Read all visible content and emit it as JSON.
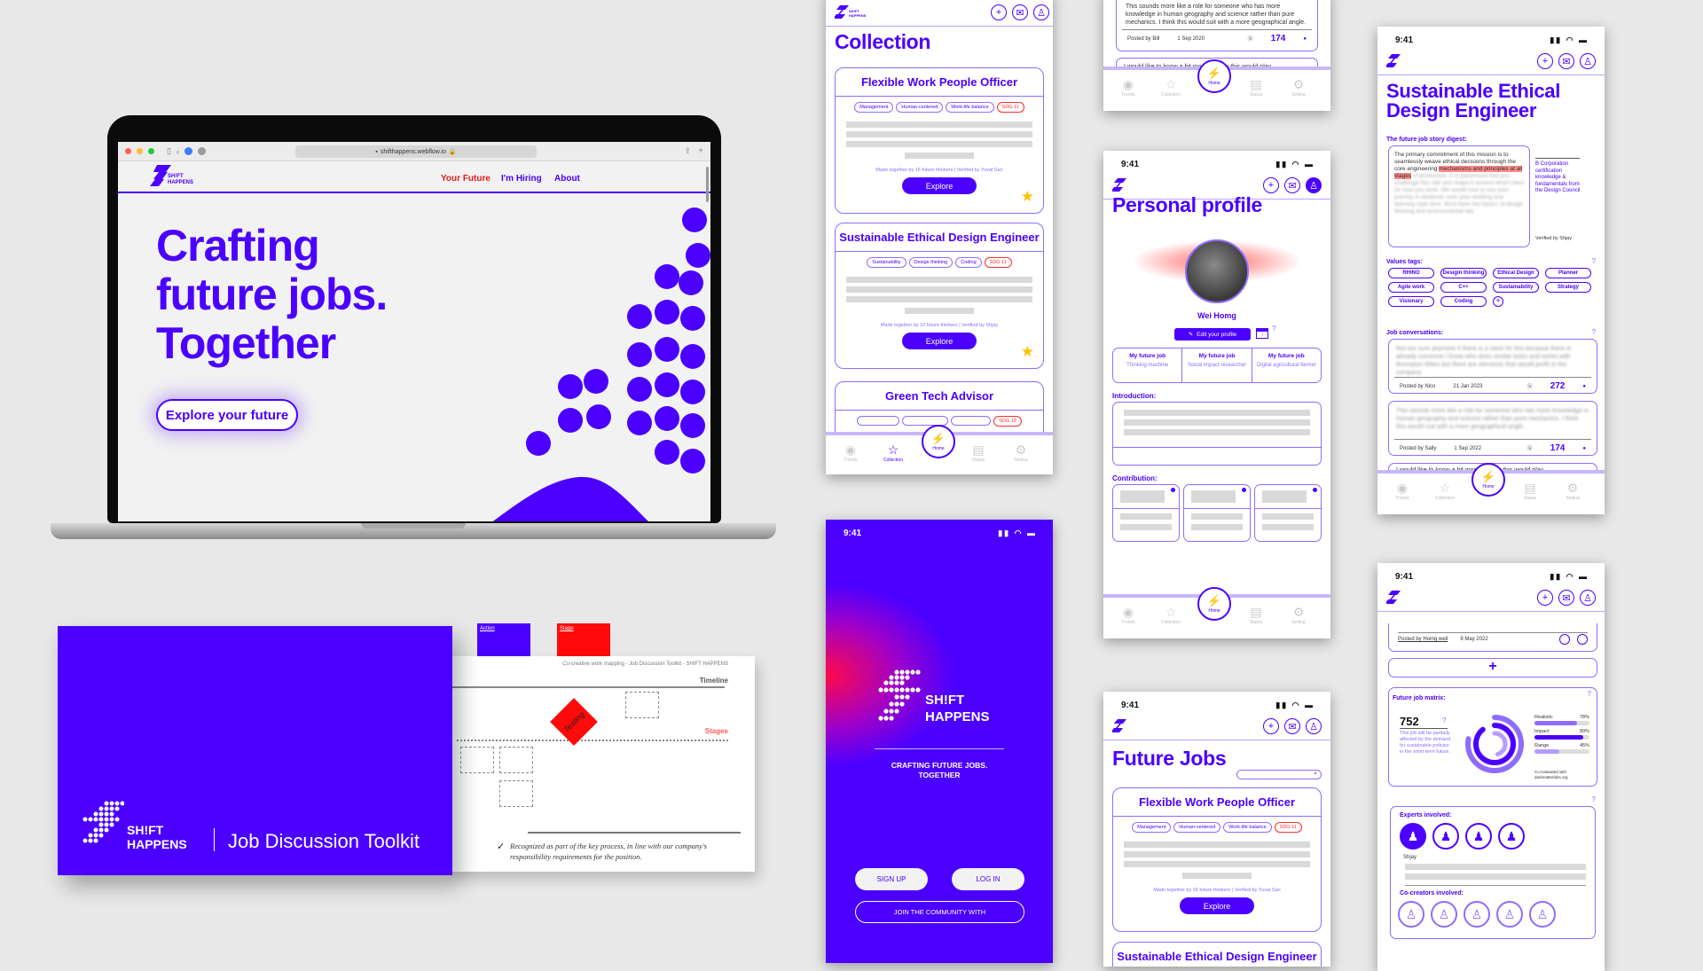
{
  "laptop": {
    "browser_url": "shifthappens.webflow.io",
    "logo_line1": "SH!FT",
    "logo_line2": "HAPPENS",
    "nav": [
      {
        "label": "Your Future",
        "active": true
      },
      {
        "label": "I'm Hiring",
        "active": false
      },
      {
        "label": "About",
        "active": false
      }
    ],
    "hero_line1": "Crafting",
    "hero_line2": "future jobs.",
    "hero_line3": "Together",
    "cta_label": "Explore your future"
  },
  "toolkit": {
    "brand_line1": "SH!FT",
    "brand_line2": "HAPPENS",
    "title": "Job Discussion Toolkit",
    "card_action": "Action",
    "card_stage": "Stage",
    "sheet_header": "Co-creative work mapping - Job Discussion Toolkit - SHIFT HAPPENS",
    "timeline_label": "Timeline",
    "stages_label": "Stages",
    "diamond_small": "Stage",
    "diamond_text": "Testing",
    "note": "Recognized as part of the key process, in line with our company's responsibility requirements for the position."
  },
  "common": {
    "time": "9:41",
    "logo_line1": "SH!FT",
    "logo_line2": "HAPPENS",
    "tabs": [
      "Trends",
      "Collection",
      "Home",
      "Status",
      "Setting"
    ]
  },
  "collection": {
    "title": "Collection",
    "cards": [
      {
        "title": "Flexible Work People Officer",
        "tags": [
          "Management",
          "Human-centered",
          "Work-life balance"
        ],
        "sdg": "SDG 11",
        "made": "Made together by 16 future thinkers | Verified by Yuval Sari",
        "button": "Explore"
      },
      {
        "title": "Sustainable Ethical Design Engineer",
        "tags": [
          "Sustainability",
          "Design thinking",
          "Coding"
        ],
        "sdg": "SDG 11",
        "made": "Made together by 16 future thinkers | Verified by Shjay",
        "button": "Explore"
      },
      {
        "title": "Green Tech Advisor",
        "tags": [
          "",
          "",
          ""
        ],
        "sdg": "SDG 13"
      }
    ],
    "active_tab": "Collection"
  },
  "splash": {
    "brand_line1": "SH!FT",
    "brand_line2": "HAPPENS",
    "tagline_line1": "CRAFTING FUTURE JOBS.",
    "tagline_line2": "TOGETHER",
    "signup": "SIGN UP",
    "login": "LOG IN",
    "join": "JOIN THE COMMUNITY WITH"
  },
  "conversation_top": {
    "text": "This sounds more like a role for someone who has more knowledge in human geography and science rather than pure mechanics. I think this would suit with a more geographical angle.",
    "posted_by": "Posted by Bill",
    "date": "1 Sep 2020",
    "count": "174",
    "next_text": "I would like to know a bit more on how this would play"
  },
  "profile": {
    "title": "Personal profile",
    "name": "Wei Homg",
    "edit_button": "Edit your profile",
    "future_jobs": [
      {
        "label": "My future job",
        "value": "Thinking machine"
      },
      {
        "label": "My future job",
        "value": "Social impact researcher"
      },
      {
        "label": "My future job",
        "value": "Digital agricultural farmer"
      }
    ],
    "introduction_label": "Introduction:",
    "contribution_label": "Contribution:"
  },
  "future_jobs": {
    "title": "Future Jobs",
    "search_placeholder": "",
    "card": {
      "title": "Flexible Work People Officer",
      "tags": [
        "Management",
        "Human-centered",
        "Work-life balance"
      ],
      "sdg": "SDG 11",
      "made": "Made together by 16 future thinkers | Verified by Yuval Sari",
      "button": "Explore"
    },
    "next_card_title": "Sustainable Ethical Design Engineer"
  },
  "job_detail": {
    "title_line1": "Sustainable Ethical",
    "title_line2": "Design Engineer",
    "digest_label": "The future job story digest:",
    "digest_text": "The primary commitment of this mission is to seamlessly weave ethical decisions through the core engineering",
    "digest_highlight": "mechanisms and principles at all stages",
    "digest_rest": "of production. It is paramount that you challenge this role and shape it around what's best for how you work. We would love to see your journey in whatever suits your working and learning style best. Must have the basics of design thinking and environmental law.",
    "side_note": "B Corporation certification knowledge & fundamentals from the Design Council",
    "verified": "Verified by Shjay",
    "values_label": "Values tags:",
    "values": [
      "RHINO",
      "Desigin thinking",
      "Ethical Design",
      "Planner",
      "Agile work",
      "C++",
      "Sustainability",
      "Strategy",
      "Visionary",
      "Coding"
    ],
    "conversations_label": "Job conversations:",
    "conversations": [
      {
        "text": "Not too sure anymore if there is a need for this because there is already someone I know who does similar tasks and works with Brompton Bikes but there are elements that would profit to the company",
        "posted_by": "Posted by Nico",
        "date": "21 Jan 2023",
        "count": "272"
      },
      {
        "text": "This sounds more like a role for someone who has more knowledge in human geography and science rather than pure mechanics. I think this would suit with a more geographical angle.",
        "posted_by": "Posted by Sally",
        "date": "1 Sep 2022",
        "count": "174"
      }
    ],
    "next_text": "I would like to know a bit more on how this would play"
  },
  "matrix": {
    "posted_by": "Posted by Homg weil",
    "date": "9 May 2022",
    "add_symbol": "+",
    "matrix_label": "Future job matrix:",
    "score": "752",
    "score_note": "This job will be partially affected by the demand for sustainable policies in the short term future.",
    "metrics": [
      {
        "label": "Realistic",
        "value": "78%",
        "fraction": 0.78,
        "color": "#8f6cff"
      },
      {
        "label": "Impact",
        "value": "89%",
        "fraction": 0.89,
        "color": "#4b00ff"
      },
      {
        "label": "Range",
        "value": "45%",
        "fraction": 0.45,
        "color": "#b79cff"
      }
    ],
    "co_eval": "Co-evaluated with darkmatterlabs.org",
    "experts_label": "Experts involved:",
    "expert_name": "Shjay",
    "cocreators_label": "Co-creators involved:"
  }
}
